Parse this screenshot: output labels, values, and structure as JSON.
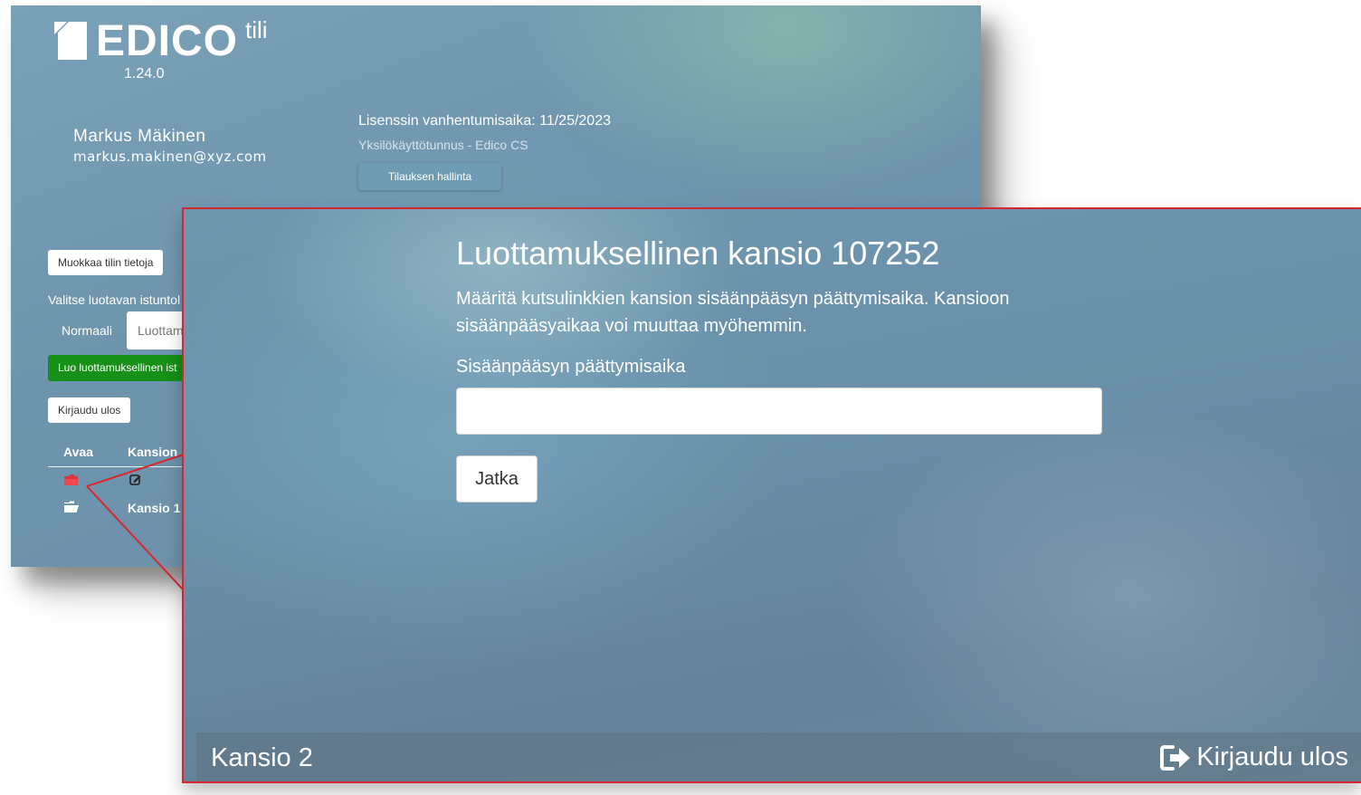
{
  "back": {
    "logo_text": "EDICO",
    "logo_sup": "tili",
    "version": "1.24.0",
    "user_name": "Markus Mäkinen",
    "user_email": "markus.makinen@xyz.com",
    "license_expiry": "Lisenssin vanhentumisaika: 11/25/2023",
    "account_type": "Yksilökäyttötunnus - Edico CS",
    "subscription_button": "Tilauksen hallinta",
    "edit_account_button": "Muokkaa tilin tietoja",
    "session_type_label": "Valitse luotavan istuntol",
    "session_options": [
      "Normaali",
      "Luottam"
    ],
    "create_session_button": "Luo luottamuksellinen ist",
    "logout_button": "Kirjaudu ulos",
    "table_headers": [
      "Avaa",
      "Kansion"
    ],
    "table_rows": [
      "Kansio 1"
    ]
  },
  "modal": {
    "title": "Luottamuksellinen kansio 107252",
    "description": "Määritä kutsulinkkien kansion sisäänpääsyn päättymisaika. Kansioon sisäänpääsyaikaa voi muuttaa myöhemmin.",
    "field_label": "Sisäänpääsyn päättymisaika",
    "field_value": "",
    "continue_button": "Jatka"
  },
  "footer": {
    "folder_name": "Kansio 2",
    "logout_label": "Kirjaudu ulos",
    "logout_icon": "sign-out-icon"
  },
  "colors": {
    "accent_red": "#d8262e",
    "green_button": "#169016",
    "background_blue": "#6e94ad"
  }
}
